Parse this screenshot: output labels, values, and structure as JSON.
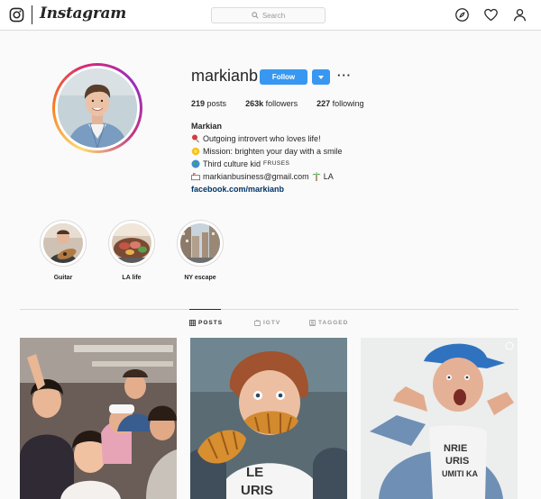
{
  "nav": {
    "wordmark": "Instagram",
    "search_placeholder": "Search",
    "icons": [
      "instagram-logo-icon",
      "compass-icon",
      "heart-icon",
      "user-icon"
    ]
  },
  "profile": {
    "username": "markianb",
    "follow_label": "Follow",
    "more_label": "···",
    "stats": {
      "posts_count": "219",
      "posts_label": "posts",
      "followers_count": "263k",
      "followers_label": "followers",
      "following_count": "227",
      "following_label": "following"
    },
    "bio": {
      "name": "Markian",
      "line1": "Outgoing introvert who loves life!",
      "line2": "Mission: brighten your day with a smile",
      "line3": "Third culture kid",
      "line3_flags": "FRUSES",
      "line4_email": "markianbusiness@gmail.com",
      "line4_location": "LA",
      "link": "facebook.com/markianb"
    }
  },
  "highlights": [
    {
      "label": "Guitar"
    },
    {
      "label": "LA life"
    },
    {
      "label": "NY escape"
    }
  ],
  "tabs": {
    "posts": "POSTS",
    "igtv": "IGTV",
    "tagged": "TAGGED",
    "active": "POSTS"
  },
  "colors": {
    "accent": "#3897f0",
    "link": "#003569",
    "text": "#262626",
    "border": "#dbdbdb",
    "background": "#fafafa"
  }
}
